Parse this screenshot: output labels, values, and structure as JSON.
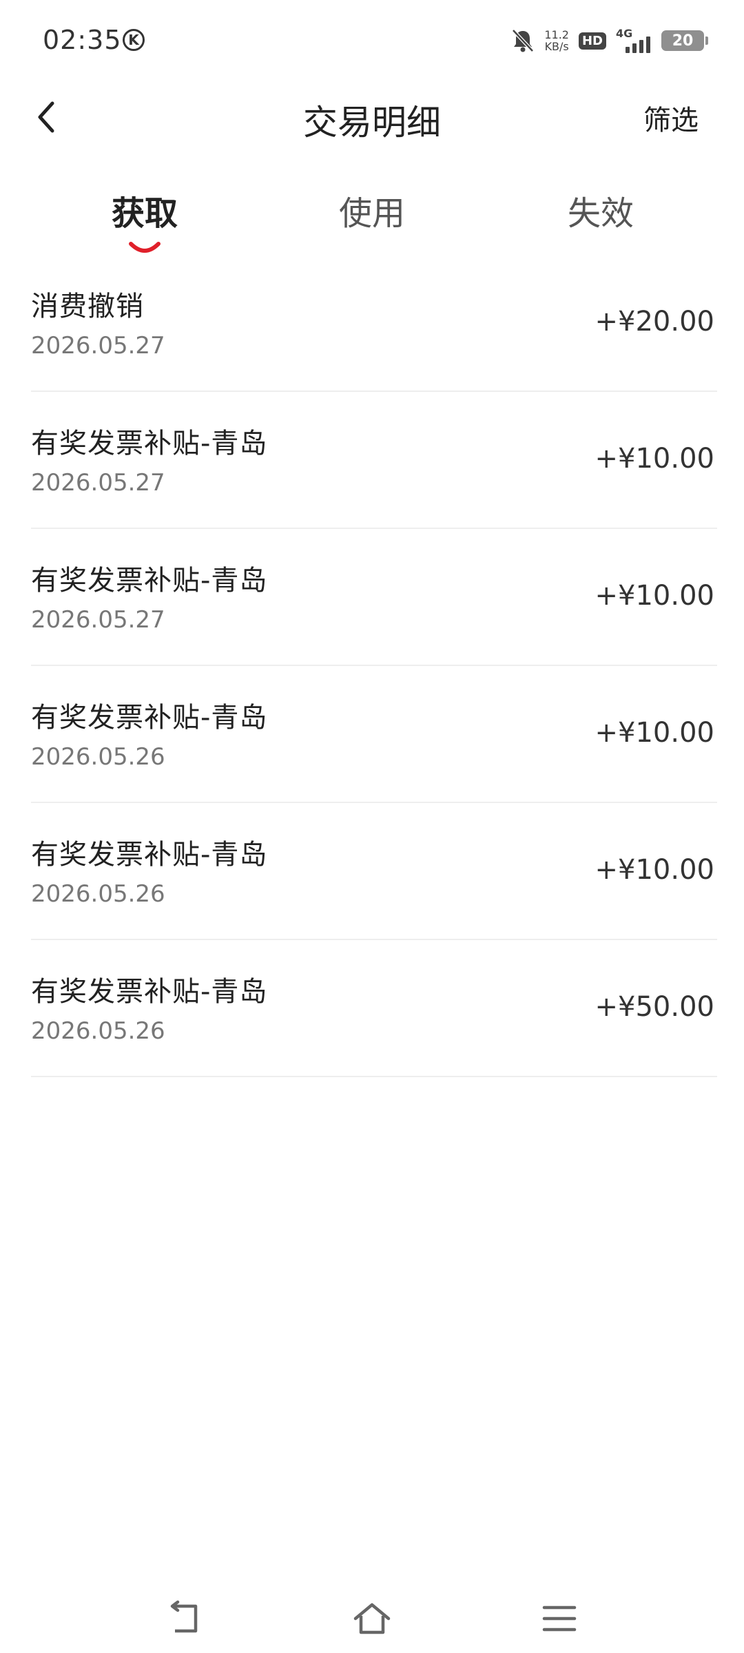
{
  "status_bar": {
    "time": "02:35",
    "k_badge": "K",
    "speed_value": "11.2",
    "speed_unit": "KB/s",
    "hd": "HD",
    "network": "4G",
    "battery": "20"
  },
  "header": {
    "back_icon": "chevron-left-icon",
    "title": "交易明细",
    "filter_label": "筛选"
  },
  "tabs": [
    {
      "label": "获取",
      "active": true
    },
    {
      "label": "使用",
      "active": false
    },
    {
      "label": "失效",
      "active": false
    }
  ],
  "accent_color": "#e0202a",
  "transactions": [
    {
      "title": "消费撤销",
      "date": "2026.05.27",
      "amount": "+¥20.00"
    },
    {
      "title": "有奖发票补贴-青岛",
      "date": "2026.05.27",
      "amount": "+¥10.00"
    },
    {
      "title": "有奖发票补贴-青岛",
      "date": "2026.05.27",
      "amount": "+¥10.00"
    },
    {
      "title": "有奖发票补贴-青岛",
      "date": "2026.05.26",
      "amount": "+¥10.00"
    },
    {
      "title": "有奖发票补贴-青岛",
      "date": "2026.05.26",
      "amount": "+¥10.00"
    },
    {
      "title": "有奖发票补贴-青岛",
      "date": "2026.05.26",
      "amount": "+¥50.00"
    }
  ],
  "nav_bar": {
    "back_icon": "nav-back-icon",
    "home_icon": "home-icon",
    "menu_icon": "menu-icon"
  }
}
